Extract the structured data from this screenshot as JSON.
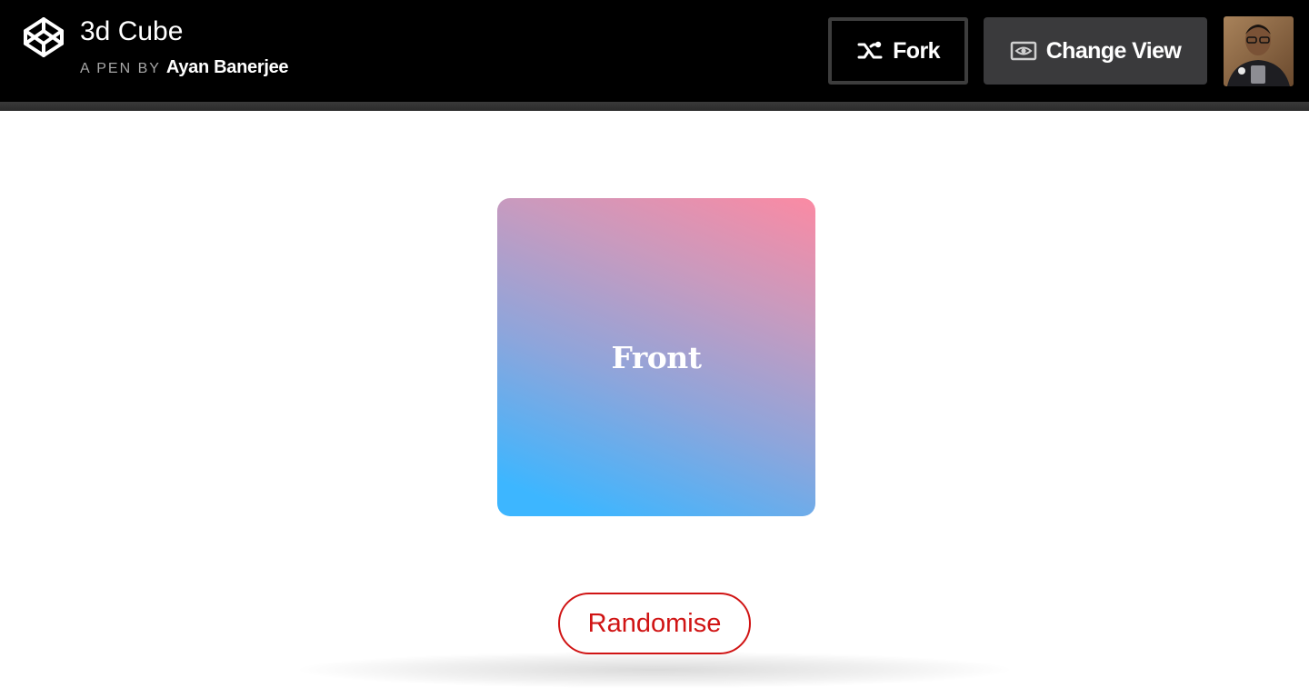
{
  "header": {
    "title": "3d Cube",
    "byline_prefix": "A PEN BY",
    "author": "Ayan Banerjee",
    "logo_icon": "codepen-logo-icon",
    "fork_button": {
      "label": "Fork",
      "icon": "fork-icon"
    },
    "change_view_button": {
      "label": "Change View",
      "icon": "eye-icon"
    },
    "avatar": "user-avatar"
  },
  "stage": {
    "cube_face_label": "Front",
    "cube_gradient": [
      "#3db6ff",
      "#fb8aa3"
    ],
    "randomise_button": "Randomise",
    "accent_color": "#d01414"
  }
}
